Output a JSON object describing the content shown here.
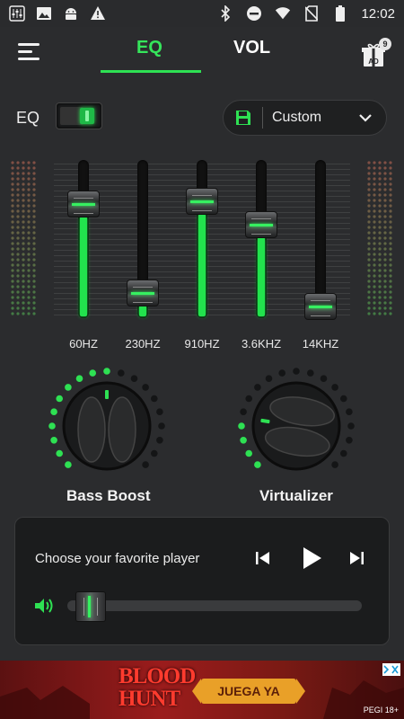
{
  "status_bar": {
    "time": "12:02",
    "left_icons": [
      "equalizer-notification-icon",
      "image-notification-icon",
      "android-notification-icon",
      "warning-notification-icon"
    ],
    "right_icons": [
      "bluetooth-icon",
      "do-not-disturb-icon",
      "wifi-icon",
      "no-sim-icon",
      "battery-icon"
    ]
  },
  "header": {
    "tabs": [
      {
        "label": "EQ",
        "active": true
      },
      {
        "label": "VOL",
        "active": false
      }
    ],
    "ad_badge_count": "9",
    "ad_label": "AD"
  },
  "eq": {
    "label": "EQ",
    "enabled": true,
    "preset": "Custom"
  },
  "bands": [
    {
      "label": "60HZ",
      "level": 0.72
    },
    {
      "label": "230HZ",
      "level": 0.11
    },
    {
      "label": "910HZ",
      "level": 0.74
    },
    {
      "label": "3.6KHZ",
      "level": 0.58
    },
    {
      "label": "14KHZ",
      "level": 0.02
    }
  ],
  "knobs": [
    {
      "label": "Bass Boost",
      "level": 0.5
    },
    {
      "label": "Virtualizer",
      "level": 0.2
    }
  ],
  "player": {
    "prompt": "Choose your favorite player",
    "volume": 0.05
  },
  "ad_banner": {
    "title": "BLOOD HUNT",
    "cta": "JUEGA YA",
    "rating": "PEGI 18+"
  },
  "colors": {
    "accent": "#2ee153",
    "background": "#2b2c2e",
    "card": "#1b1c1d"
  }
}
